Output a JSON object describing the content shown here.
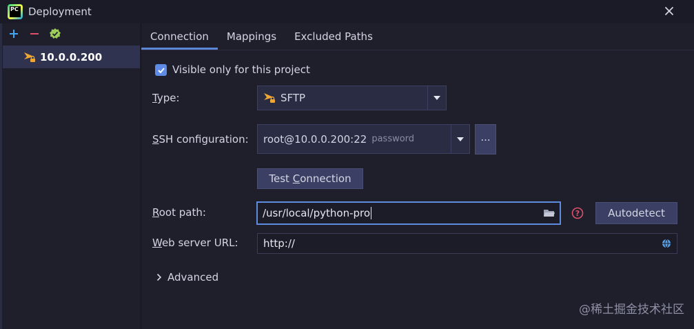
{
  "window": {
    "title": "Deployment",
    "app_logo_text": "PC"
  },
  "sidebar": {
    "toolbar": {
      "add_icon": "plus-icon",
      "remove_icon": "minus-icon",
      "default_icon": "check-badge-icon"
    },
    "servers": [
      {
        "label": "10.0.0.200",
        "icon": "sftp-server-icon"
      }
    ]
  },
  "tabs": [
    {
      "label": "Connection",
      "active": true
    },
    {
      "label": "Mappings",
      "active": false
    },
    {
      "label": "Excluded Paths",
      "active": false
    }
  ],
  "connection": {
    "visible_only": {
      "label": "Visible only for this project",
      "checked": true
    },
    "type": {
      "label_prefix": "T",
      "label_rest": "ype:",
      "value": "SFTP"
    },
    "ssh": {
      "label_prefix": "S",
      "label_rest": "SH configuration:",
      "value": "root@10.0.0.200:22",
      "hint": "password",
      "browse_label": "..."
    },
    "test_connection": {
      "label_pre": "Test ",
      "label_u": "C",
      "label_post": "onnection"
    },
    "root_path": {
      "label_prefix": "R",
      "label_rest": "oot path:",
      "value": "/usr/local/python-pro",
      "autodetect_label": "Autodetect"
    },
    "web_server": {
      "label_prefix": "W",
      "label_rest": "eb server URL:",
      "value": "http://"
    },
    "advanced": {
      "label": "Advanced"
    }
  },
  "watermark": "@稀土掘金技术社区",
  "colors": {
    "accent": "#5e8de0",
    "background": "#1e1f2b",
    "selected_row": "#2f3350",
    "help_icon": "#e0506a"
  }
}
